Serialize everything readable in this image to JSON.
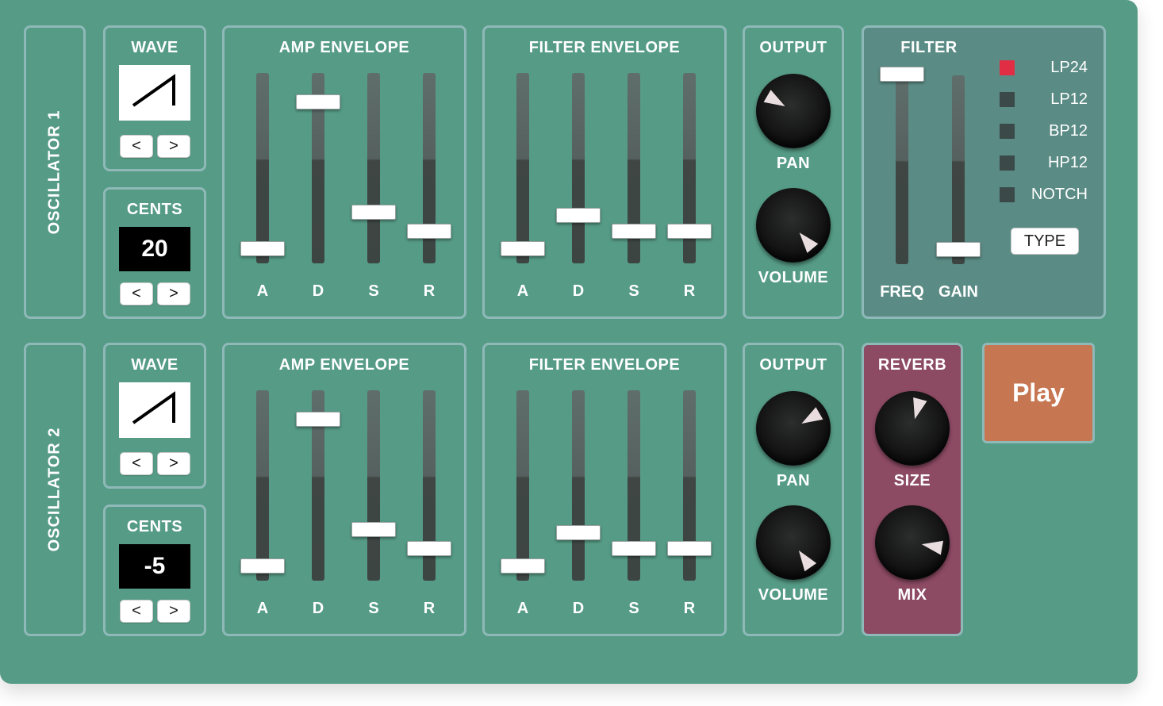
{
  "osc1": {
    "name": "OSCILLATOR 1",
    "wave": {
      "title": "WAVE",
      "shape": "sawtooth-icon",
      "prev": "<",
      "next": ">"
    },
    "cents": {
      "title": "CENTS",
      "value": "20",
      "prev": "<",
      "next": ">"
    },
    "amp_env": {
      "title": "AMP ENVELOPE",
      "sliders": [
        {
          "label": "A",
          "level": 0.04
        },
        {
          "label": "D",
          "level": 0.88
        },
        {
          "label": "S",
          "level": 0.25
        },
        {
          "label": "R",
          "level": 0.14
        }
      ]
    },
    "filter_env": {
      "title": "FILTER ENVELOPE",
      "sliders": [
        {
          "label": "A",
          "level": 0.04
        },
        {
          "label": "D",
          "level": 0.23
        },
        {
          "label": "S",
          "level": 0.14
        },
        {
          "label": "R",
          "level": 0.14
        }
      ]
    },
    "output": {
      "title": "OUTPUT",
      "pan_label": "PAN",
      "pan_angle": -60,
      "volume_label": "VOLUME",
      "volume_angle": 140
    },
    "filter": {
      "title": "FILTER",
      "freq_label": "FREQ",
      "gain_label": "GAIN",
      "freq_level": 1.0,
      "gain_level": 0.04,
      "types": [
        {
          "label": "LP24",
          "active": true
        },
        {
          "label": "LP12",
          "active": false
        },
        {
          "label": "BP12",
          "active": false
        },
        {
          "label": "HP12",
          "active": false
        },
        {
          "label": "NOTCH",
          "active": false
        }
      ],
      "type_button": "TYPE"
    }
  },
  "osc2": {
    "name": "OSCILLATOR 2",
    "wave": {
      "title": "WAVE",
      "shape": "sawtooth-icon",
      "prev": "<",
      "next": ">"
    },
    "cents": {
      "title": "CENTS",
      "value": "-5",
      "prev": "<",
      "next": ">"
    },
    "amp_env": {
      "title": "AMP ENVELOPE",
      "sliders": [
        {
          "label": "A",
          "level": 0.04
        },
        {
          "label": "D",
          "level": 0.88
        },
        {
          "label": "S",
          "level": 0.25
        },
        {
          "label": "R",
          "level": 0.14
        }
      ]
    },
    "filter_env": {
      "title": "FILTER ENVELOPE",
      "sliders": [
        {
          "label": "A",
          "level": 0.04
        },
        {
          "label": "D",
          "level": 0.23
        },
        {
          "label": "S",
          "level": 0.14
        },
        {
          "label": "R",
          "level": 0.14
        }
      ]
    },
    "output": {
      "title": "OUTPUT",
      "pan_label": "PAN",
      "pan_angle": 60,
      "volume_label": "VOLUME",
      "volume_angle": 145
    }
  },
  "reverb": {
    "title": "REVERB",
    "size_label": "SIZE",
    "size_angle": 15,
    "mix_label": "MIX",
    "mix_angle": 100
  },
  "play_label": "Play",
  "colors": {
    "body": "#559b85",
    "filter_panel": "#5a8b84",
    "reverb_panel": "#8c4a63",
    "play_button": "#c67650",
    "led_on": "#e22e45",
    "led_off": "#3b4a49"
  }
}
